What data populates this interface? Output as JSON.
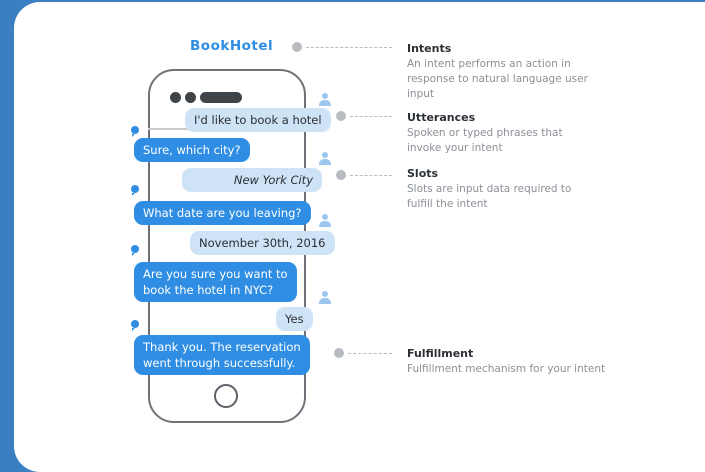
{
  "app_title": "BookHotel",
  "conversation": [
    {
      "speaker": "user",
      "text": "I'd like to book a hotel"
    },
    {
      "speaker": "bot",
      "text": "Sure, which city?"
    },
    {
      "speaker": "user",
      "text": "New York City",
      "italic": true
    },
    {
      "speaker": "bot",
      "text": "What date are you leaving?"
    },
    {
      "speaker": "user",
      "text": "November 30th, 2016"
    },
    {
      "speaker": "bot",
      "lines": [
        "Are you sure you want to",
        "book the hotel in NYC?"
      ]
    },
    {
      "speaker": "user",
      "text": "Yes"
    },
    {
      "speaker": "bot",
      "lines": [
        "Thank you. The reservation",
        "went through successfully."
      ]
    }
  ],
  "annotations": [
    {
      "title": "Intents",
      "lines": [
        "An intent performs an action in",
        "response to natural language user",
        "input"
      ]
    },
    {
      "title": "Utterances",
      "lines": [
        "Spoken or typed phrases that",
        "invoke your intent"
      ]
    },
    {
      "title": "Slots",
      "lines": [
        "Slots are input data required to",
        "fulfill the intent"
      ]
    },
    {
      "title": "Fulfillment",
      "lines": [
        "Fulfillment mechanism for your intent"
      ]
    }
  ],
  "colors": {
    "accent": "#2f8ee3",
    "user_bubble": "#cfe3f7",
    "frame": "#3a7fc2"
  },
  "icons": {
    "user": "person-icon",
    "bot": "chat-bubble-icon"
  }
}
